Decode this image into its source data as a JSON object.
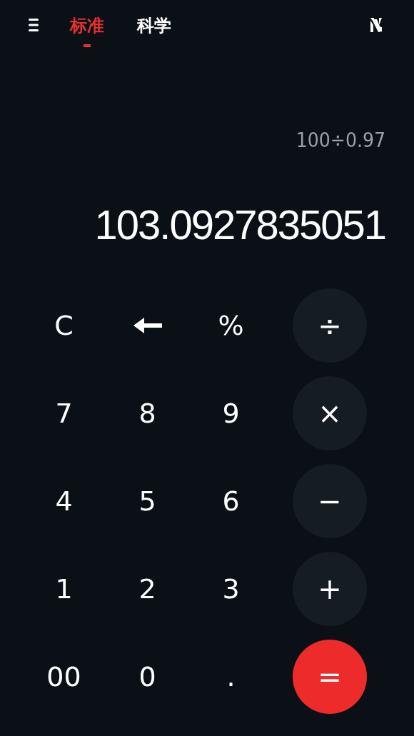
{
  "tabs": [
    {
      "label": "标准",
      "selected": true
    },
    {
      "label": "科学",
      "selected": false
    }
  ],
  "display": {
    "expression": "100÷0.97",
    "result": "103.0927835051"
  },
  "keys": [
    {
      "kind": "digit",
      "label": "C"
    },
    {
      "kind": "backspace"
    },
    {
      "kind": "digit",
      "label": "%"
    },
    {
      "kind": "operator",
      "label": "÷"
    },
    {
      "kind": "digit",
      "label": "7"
    },
    {
      "kind": "digit",
      "label": "8"
    },
    {
      "kind": "digit",
      "label": "9"
    },
    {
      "kind": "operator",
      "label": "×"
    },
    {
      "kind": "digit",
      "label": "4"
    },
    {
      "kind": "digit",
      "label": "5"
    },
    {
      "kind": "digit",
      "label": "6"
    },
    {
      "kind": "operator",
      "label": "−"
    },
    {
      "kind": "digit",
      "label": "1"
    },
    {
      "kind": "digit",
      "label": "2"
    },
    {
      "kind": "digit",
      "label": "3"
    },
    {
      "kind": "operator",
      "label": "+"
    },
    {
      "kind": "digit",
      "label": "00"
    },
    {
      "kind": "digit",
      "label": "0"
    },
    {
      "kind": "digit",
      "label": "."
    },
    {
      "kind": "equals",
      "label": "="
    }
  ]
}
